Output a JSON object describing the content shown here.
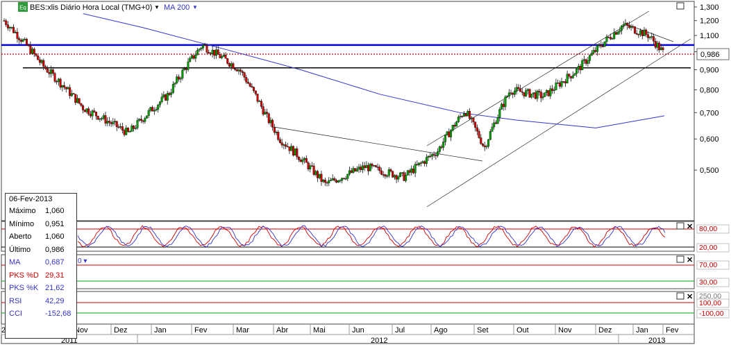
{
  "header": {
    "app_icon": "Eq",
    "symbol": "BES:xlis Diário Hora Local (TMG+0)",
    "ma_label": "MA 200"
  },
  "price_axis": {
    "ticks": [
      "1,300",
      "1,200",
      "1,100",
      "1,000",
      "0,900",
      "0,800",
      "0,700",
      "0,600",
      "0,500"
    ],
    "current_label": "0,986"
  },
  "indicators": [
    {
      "id": "pks",
      "levels": [
        "80,00",
        "20,00"
      ]
    },
    {
      "id": "rsi",
      "levels": [
        "70,00",
        "30,00"
      ],
      "header_fragment": "0 ▾"
    },
    {
      "id": "cci",
      "levels": [
        "250,00",
        "100,00",
        "-100,00"
      ]
    }
  ],
  "time_axis": {
    "months": [
      "2011",
      "Out",
      "Nov",
      "Dez",
      "Jan",
      "Fev",
      "Mar",
      "Abr",
      "Mai",
      "Jun",
      "Jul",
      "Ago",
      "Set",
      "Out",
      "Nov",
      "Dez",
      "Jan",
      "Fev"
    ],
    "years": [
      "2011",
      "2012",
      "2013"
    ]
  },
  "info": {
    "date": "06-Fev-2013",
    "rows": [
      {
        "label": "Máximo",
        "value": "1,060"
      },
      {
        "label": "Mínimo",
        "value": "0,951"
      },
      {
        "label": "Aberto",
        "value": "1,060"
      },
      {
        "label": "Último",
        "value": "0,986"
      },
      {
        "label": "MA",
        "value": "0,687"
      },
      {
        "label": "PKS %D",
        "value": "29,31"
      },
      {
        "label": "PKS %K",
        "value": "21,62"
      },
      {
        "label": "RSI",
        "value": "42,29"
      },
      {
        "label": "CCI",
        "value": "-152,68"
      }
    ]
  },
  "colors": {
    "up": "#00a000",
    "down": "#d00000",
    "ma": "#3333cc",
    "resistance": "#0000cc",
    "support": "#000000",
    "last_price": "#cc0000",
    "overbought": "#cc0000",
    "oversold": "#00a000",
    "pks_k": "#3333cc",
    "pks_d": "#cc0000",
    "ma_color": "#3333cc",
    "pks_d_color": "#cc0000",
    "pks_k_color": "#3333cc",
    "rsi_color": "#3333cc",
    "cci_color": "#3333cc"
  },
  "chart_data": {
    "type": "candlestick",
    "title": "BES:xlis Diário Hora Local (TMG+0)",
    "ylim": [
      0.4,
      1.3
    ],
    "y_scale": "log",
    "price_reference": {
      "last": 0.986,
      "support": 0.91,
      "resistance": 1.04
    },
    "moving_average": {
      "name": "MA 200",
      "x": [
        "2011-11-15",
        "2012-01-01",
        "2012-03-01",
        "2012-05-01",
        "2012-07-01",
        "2012-09-01",
        "2012-10-15",
        "2012-12-15",
        "2013-02-06"
      ],
      "values": [
        1.25,
        1.15,
        1.02,
        0.9,
        0.78,
        0.7,
        0.67,
        0.64,
        0.687
      ]
    },
    "price_series": {
      "x": [
        "2011-09-15",
        "2011-10-15",
        "2011-11-15",
        "2011-12-20",
        "2012-01-20",
        "2012-02-15",
        "2012-03-15",
        "2012-04-05",
        "2012-04-15",
        "2012-05-20",
        "2012-06-20",
        "2012-07-20",
        "2012-08-15",
        "2012-09-05",
        "2012-09-20",
        "2012-10-10",
        "2012-11-05",
        "2012-12-01",
        "2013-01-05",
        "2013-01-25",
        "2013-02-06"
      ],
      "values": [
        1.2,
        0.92,
        0.72,
        0.62,
        0.78,
        1.04,
        0.9,
        0.68,
        0.6,
        0.46,
        0.51,
        0.48,
        0.56,
        0.71,
        0.57,
        0.8,
        0.77,
        0.9,
        1.17,
        1.1,
        0.986
      ]
    },
    "indicators": {
      "PKS %D": 29.31,
      "PKS %K": 21.62,
      "RSI": 42.29,
      "CCI": -152.68
    }
  }
}
